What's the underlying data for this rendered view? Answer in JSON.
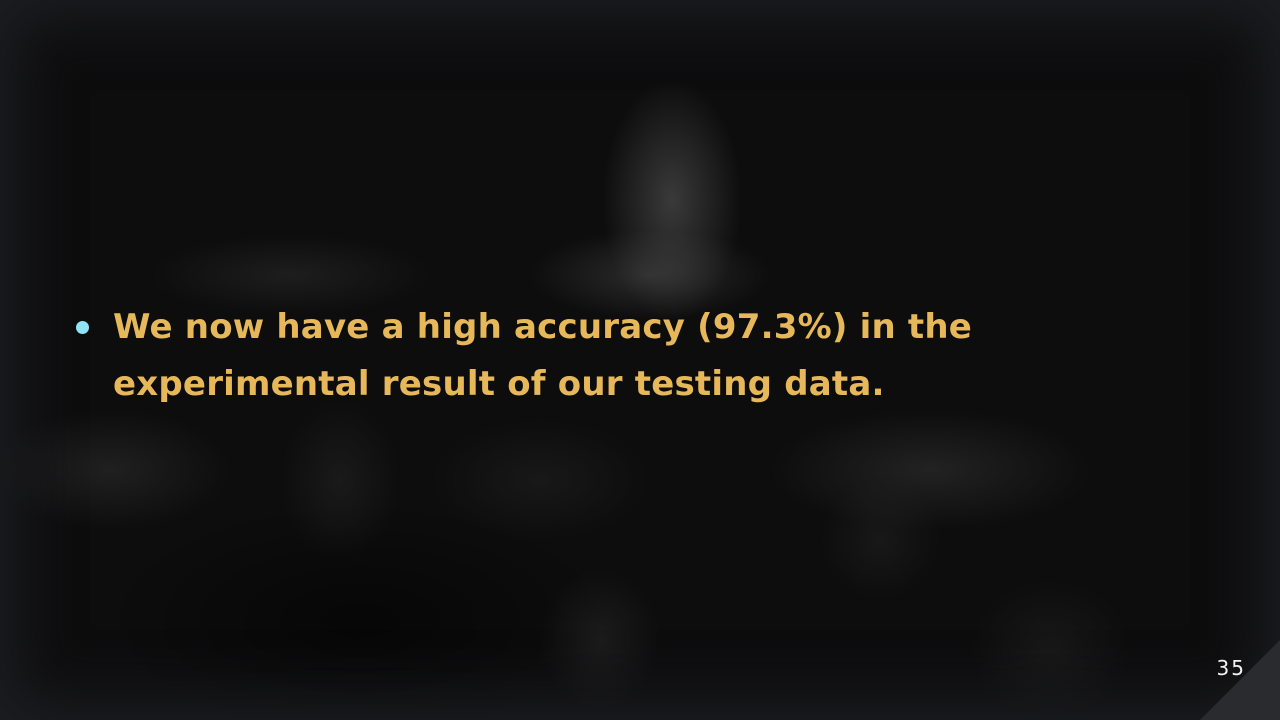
{
  "slide": {
    "bullets": [
      {
        "text": "We now have a high accuracy (97.3%) in the experimental result of our testing data."
      }
    ],
    "page_number": "35"
  },
  "colors": {
    "bullet_text": "#e6b85a",
    "bullet_marker": "#8fe3f5",
    "background": "#0d0d0e",
    "page_number": "#f2f2f2"
  }
}
